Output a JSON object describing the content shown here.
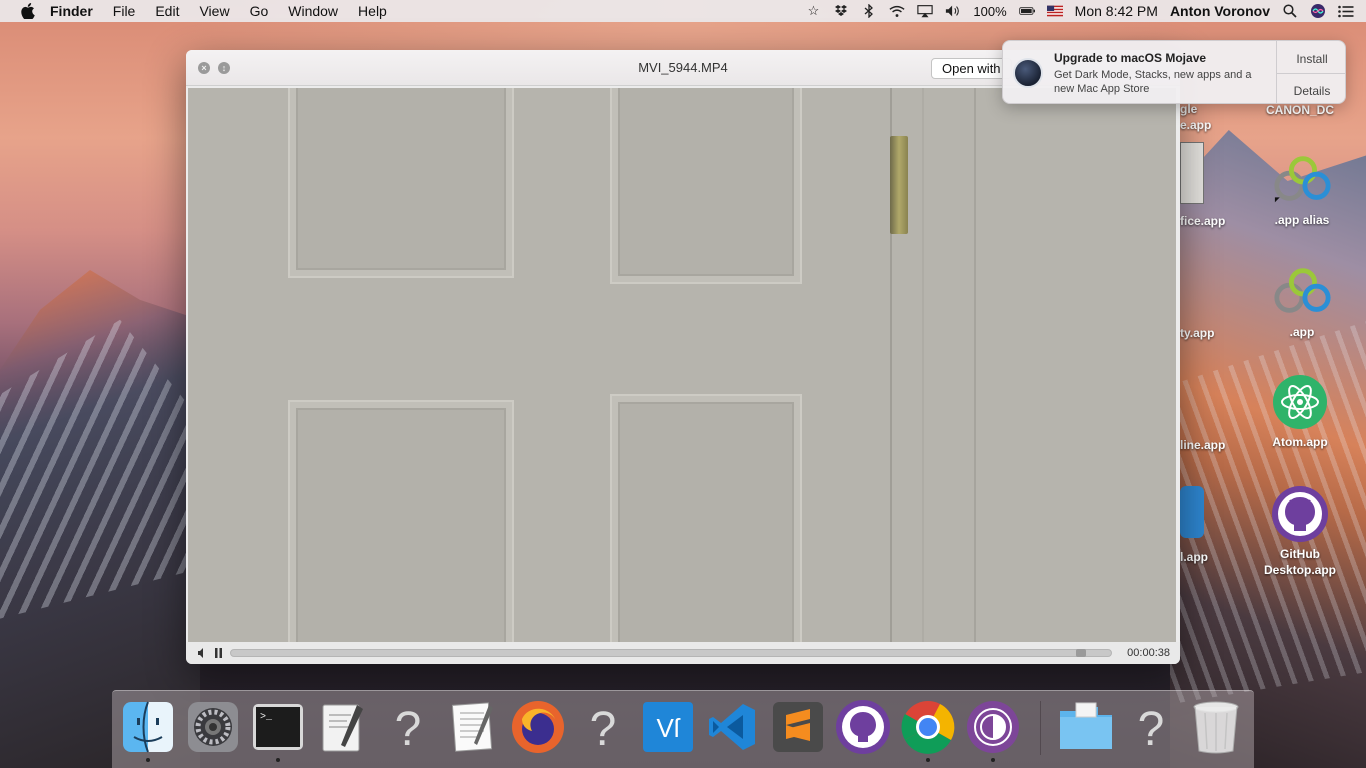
{
  "menubar": {
    "app_name": "Finder",
    "menus": [
      "File",
      "Edit",
      "View",
      "Go",
      "Window",
      "Help"
    ],
    "battery": "100%",
    "clock": "Mon 8:42 PM",
    "user": "Anton Voronov"
  },
  "quicklook": {
    "title": "MVI_5944.MP4",
    "open_button": "Open with",
    "time": "00:00:38"
  },
  "notification": {
    "title": "Upgrade to macOS Mojave",
    "body": "Get Dark Mode, Stacks, new apps and a new Mac App Store",
    "install": "Install",
    "details": "Details"
  },
  "desktop": {
    "icons": [
      {
        "label": "CANON_DC"
      },
      {
        "label": ".app alias"
      },
      {
        "label": ".app"
      },
      {
        "label": "Atom.app"
      },
      {
        "label": "GitHub Desktop.app"
      }
    ],
    "partials": [
      "gle",
      "e.app",
      "fice.app",
      "ty.app",
      "line.app",
      "l.app"
    ]
  },
  "colors": {
    "atom_green": "#2fb36a",
    "github_purple": "#6e3f9e",
    "firefox_orange": "#e8642c",
    "vscode_blue": "#1f86d8",
    "sublime_orange": "#f58c1f",
    "chrome_red": "#db4437",
    "tor_purple": "#7d4698",
    "folder_blue": "#5db4ec"
  }
}
